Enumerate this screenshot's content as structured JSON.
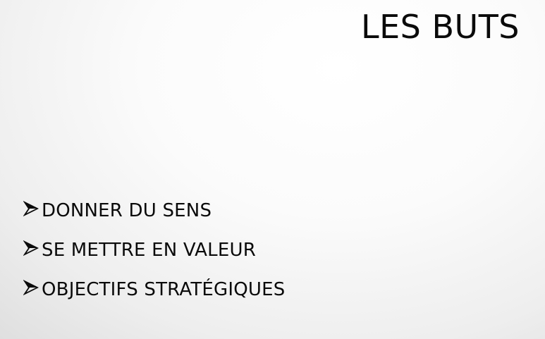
{
  "slide": {
    "title": "LES BUTS",
    "bullets": [
      {
        "icon": "arrowhead-bullet-icon",
        "label": "DONNER DU SENS"
      },
      {
        "icon": "arrowhead-bullet-icon",
        "label": "SE METTRE EN VALEUR"
      },
      {
        "icon": "arrowhead-bullet-icon",
        "label": "OBJECTIFS STRATÉGIQUES"
      }
    ]
  }
}
